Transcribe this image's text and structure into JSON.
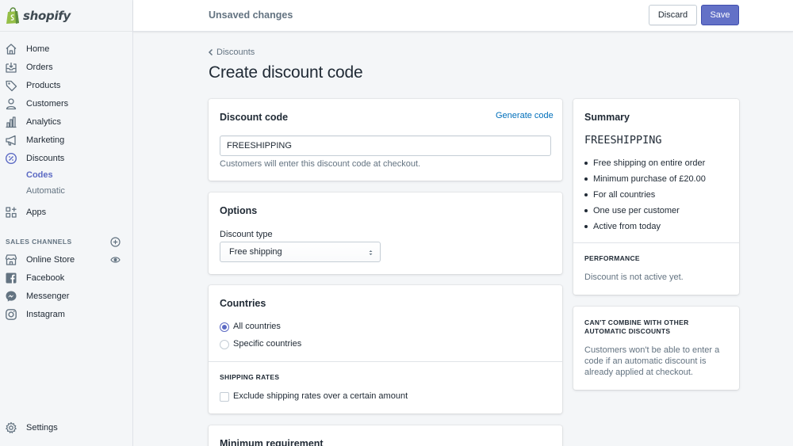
{
  "app": {
    "logo_text": "shopify"
  },
  "topbar": {
    "title": "Unsaved changes",
    "discard_label": "Discard",
    "save_label": "Save"
  },
  "sidebar": {
    "items": [
      {
        "label": "Home",
        "icon": "home-icon"
      },
      {
        "label": "Orders",
        "icon": "orders-icon"
      },
      {
        "label": "Products",
        "icon": "tag-icon"
      },
      {
        "label": "Customers",
        "icon": "person-icon"
      },
      {
        "label": "Analytics",
        "icon": "bar-chart-icon"
      },
      {
        "label": "Marketing",
        "icon": "megaphone-icon"
      },
      {
        "label": "Discounts",
        "icon": "discount-icon"
      }
    ],
    "discount_sub": [
      {
        "label": "Codes",
        "active": true
      },
      {
        "label": "Automatic",
        "active": false
      }
    ],
    "apps_label": "Apps",
    "sales_channels_title": "SALES CHANNELS",
    "channels": [
      {
        "label": "Online Store",
        "icon": "store-icon"
      },
      {
        "label": "Facebook",
        "icon": "facebook-icon"
      },
      {
        "label": "Messenger",
        "icon": "messenger-icon"
      },
      {
        "label": "Instagram",
        "icon": "instagram-icon"
      }
    ],
    "settings_label": "Settings"
  },
  "page": {
    "breadcrumb": "Discounts",
    "title": "Create discount code"
  },
  "discount_code_card": {
    "title": "Discount code",
    "generate_link": "Generate code",
    "code_value": "FREESHIPPING",
    "help": "Customers will enter this discount code at checkout."
  },
  "options_card": {
    "title": "Options",
    "type_label": "Discount type",
    "type_value": "Free shipping"
  },
  "countries_card": {
    "title": "Countries",
    "options": [
      {
        "label": "All countries",
        "checked": true
      },
      {
        "label": "Specific countries",
        "checked": false
      }
    ],
    "shipping_rates_title": "SHIPPING RATES",
    "exclude_label": "Exclude shipping rates over a certain amount"
  },
  "min_req_card": {
    "title": "Minimum requirement"
  },
  "summary_card": {
    "title": "Summary",
    "code": "FREESHIPPING",
    "items": [
      "Free shipping on entire order",
      "Minimum purchase of £20.00",
      "For all countries",
      "One use per customer",
      "Active from today"
    ],
    "performance_title": "PERFORMANCE",
    "performance_text": "Discount is not active yet."
  },
  "combine_card": {
    "title_line1": "CAN'T COMBINE WITH OTHER",
    "title_line2": "AUTOMATIC DISCOUNTS",
    "text_line1": "Customers won't be able to enter a",
    "text_line2": "code if an automatic discount is",
    "text_line3": "already applied at checkout."
  },
  "colors": {
    "accent": "#5c6ac4",
    "save_button": "#6371c7",
    "link": "#006fbb",
    "background": "#f4f6f8"
  }
}
